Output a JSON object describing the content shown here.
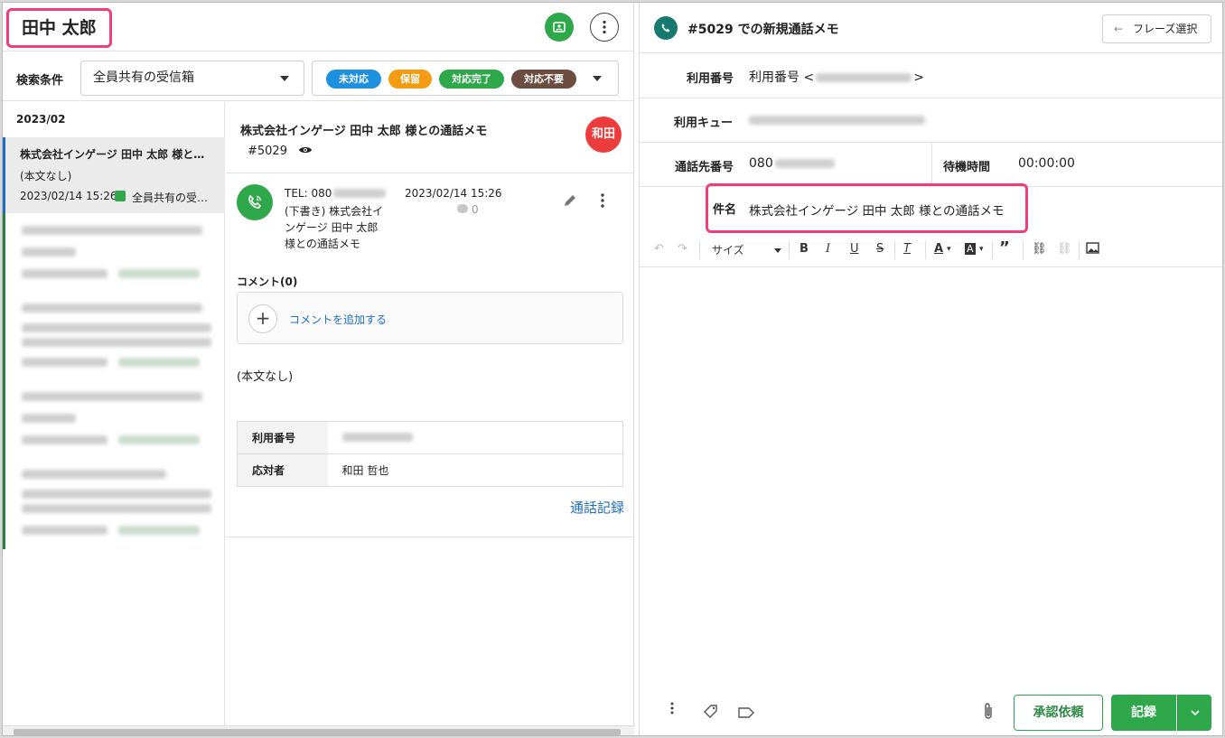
{
  "customer": {
    "name": "田中 太郎"
  },
  "filters": {
    "label": "検索条件",
    "inbox": "全員共有の受信箱",
    "statuses": [
      {
        "label": "未対応",
        "color": "#1e90e0"
      },
      {
        "label": "保留",
        "color": "#f39c12"
      },
      {
        "label": "対応完了",
        "color": "#2ea84a"
      },
      {
        "label": "対応不要",
        "color": "#6d4c41"
      }
    ]
  },
  "list": {
    "month": "2023/02",
    "active_item": {
      "title": "株式会社インゲージ 田中 太郎 様と…",
      "body": "(本文なし)",
      "date": "2023/02/14 15:26",
      "inbox": "全員共有の受…"
    }
  },
  "detail": {
    "title": "株式会社インゲージ 田中 太郎 様との通話メモ",
    "id": "#5029",
    "assignee_avatar": "和田",
    "call": {
      "tel": "TEL: 080",
      "draft": "(下書き) 株式会社インゲージ 田中 太郎 様との通話メモ",
      "date": "2023/02/14 15:26",
      "comment_count": "0"
    },
    "comments_label": "コメント(0)",
    "add_comment": "コメントを追加する",
    "body": "(本文なし)",
    "table": [
      {
        "key": "利用番号",
        "value": ""
      },
      {
        "key": "応対者",
        "value": "和田 哲也"
      }
    ],
    "call_log_link": "通話記録"
  },
  "memo": {
    "title": "#5029 での新規通話メモ",
    "phrase_button": "フレーズ選択",
    "usage_number_label": "利用番号",
    "usage_number_value": "利用番号 <",
    "usage_number_suffix": ">",
    "queue_label": "利用キュー",
    "dest_label": "通話先番号",
    "dest_value": "080",
    "wait_label": "待機時間",
    "wait_value": "00:00:00",
    "subject_label": "件名",
    "subject_value": "株式会社インゲージ 田中 太郎 様との通話メモ",
    "size_label": "サイズ",
    "approve_button": "承認依頼",
    "record_button": "記録"
  }
}
